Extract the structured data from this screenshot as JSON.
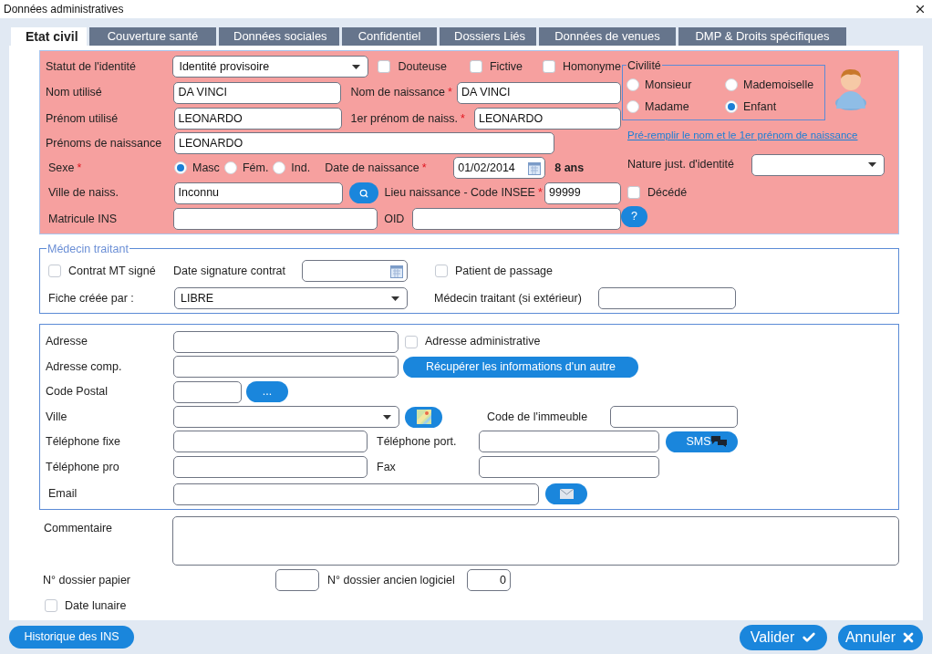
{
  "window": {
    "title": "Données administratives"
  },
  "tabs": [
    {
      "label": "Etat civil",
      "selected": true
    },
    {
      "label": "Couverture santé",
      "selected": false
    },
    {
      "label": "Données sociales",
      "selected": false
    },
    {
      "label": "Confidentiel",
      "selected": false
    },
    {
      "label": "Dossiers Liés",
      "selected": false
    },
    {
      "label": "Données de venues",
      "selected": false
    },
    {
      "label": "DMP & Droits spécifiques",
      "selected": false
    }
  ],
  "identity": {
    "status": {
      "label": "Statut de l'identité",
      "value": "Identité provisoire"
    },
    "flags": [
      {
        "label": "Douteuse",
        "checked": false
      },
      {
        "label": "Fictive",
        "checked": false
      },
      {
        "label": "Homonyme",
        "checked": false
      }
    ],
    "used_name": {
      "label": "Nom utilisé",
      "value": "DA VINCI"
    },
    "birth_name": {
      "label": "Nom de naissance",
      "required": "*",
      "value": "DA VINCI"
    },
    "used_first_name": {
      "label": "Prénom utilisé",
      "value": "LEONARDO"
    },
    "first_birth_name": {
      "label": "1er prénom de naiss.",
      "required": "*",
      "value": "LEONARDO"
    },
    "birth_first_names": {
      "label": "Prénoms de naissance",
      "value": "LEONARDO"
    },
    "sex": {
      "label": "Sexe",
      "required": "*",
      "options": [
        {
          "label": "Masc",
          "selected": true
        },
        {
          "label": "Fém.",
          "selected": false
        },
        {
          "label": "Ind.",
          "selected": false
        }
      ]
    },
    "birth_date": {
      "label": "Date de naissance",
      "required": "*",
      "value": "01/02/2014",
      "age": "8 ans"
    },
    "birth_city": {
      "label": "Ville de naiss.",
      "value": "Inconnu"
    },
    "insee_code": {
      "label": "Lieu naissance - Code INSEE",
      "required": "*",
      "value": "99999"
    },
    "ins_number": {
      "label": "Matricule INS"
    },
    "oid": {
      "label": "OID"
    },
    "civility": {
      "legend": "Civilité",
      "options": [
        {
          "label": "Monsieur",
          "selected": false
        },
        {
          "label": "Mademoiselle",
          "selected": false
        },
        {
          "label": "Madame",
          "selected": false
        },
        {
          "label": "Enfant",
          "selected": true
        }
      ]
    },
    "prefill_link": "Pré-remplir le nom et le 1er prénom de naissance",
    "identity_proof": {
      "label": "Nature just. d'identité"
    },
    "deceased": {
      "label": "Décédé",
      "checked": false
    },
    "help_button": "?"
  },
  "doctor": {
    "legend": "Médecin traitant",
    "contract_signed": {
      "label": "Contrat MT signé",
      "checked": false
    },
    "signature_date": {
      "label": "Date signature contrat"
    },
    "passing_patient": {
      "label": "Patient de passage",
      "checked": false
    },
    "created_by": {
      "label": "Fiche créée par :",
      "value": "LIBRE"
    },
    "external_doctor": {
      "label": "Médecin traitant (si extérieur)"
    }
  },
  "address": {
    "street": {
      "label": "Adresse"
    },
    "administrative": {
      "label": "Adresse administrative",
      "checked": false
    },
    "complement": {
      "label": "Adresse comp."
    },
    "fetch_button": "Récupérer les informations d'un autre",
    "postal_code": {
      "label": "Code Postal"
    },
    "more_button": "...",
    "city": {
      "label": "Ville"
    },
    "building_code": {
      "label": "Code de l'immeuble"
    },
    "phone": {
      "label": "Téléphone fixe"
    },
    "mobile": {
      "label": "Téléphone port."
    },
    "sms_button": "SMS",
    "work_phone": {
      "label": "Téléphone pro"
    },
    "fax": {
      "label": "Fax"
    },
    "email": {
      "label": "Email"
    }
  },
  "comment": {
    "label": "Commentaire"
  },
  "paper_file": {
    "label": "N° dossier papier"
  },
  "legacy_file": {
    "label": "N° dossier ancien logiciel",
    "value": "0"
  },
  "lunar_date": {
    "label": "Date lunaire",
    "checked": false
  },
  "footer": {
    "history_button": "Historique des INS",
    "validate_button": "Valider",
    "cancel_button": "Annuler"
  }
}
